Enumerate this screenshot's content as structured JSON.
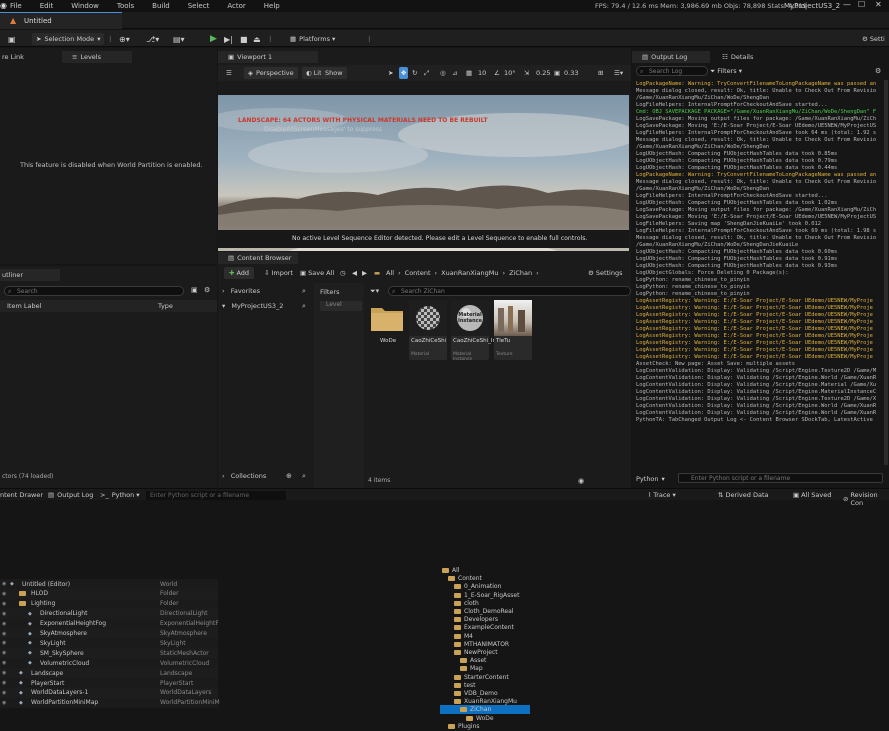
{
  "menu": [
    "File",
    "Edit",
    "Window",
    "Tools",
    "Build",
    "Select",
    "Actor",
    "Help"
  ],
  "stats": "FPS: 79.4   /   12.6 ms   Mem: 3,986.69 mb   Objs: 78,898   Stats: 4,019",
  "project_name": "MyProjectUS3_2",
  "window_controls": {
    "minimize": "—",
    "maximize": "☐",
    "close": "✕"
  },
  "doc_tab": "Untitled",
  "toolbar": {
    "selection_mode": "Selection Mode",
    "platforms": "Platforms",
    "settings": "Setti"
  },
  "left_panel": {
    "tab_link": "re Link",
    "tab_levels": "Levels",
    "disabled_msg": "This feature is disabled when World Partition is enabled."
  },
  "viewport": {
    "tab": "Viewport 1",
    "perspective": "Perspective",
    "lit": "Lit",
    "show": "Show",
    "grid": "10",
    "angle": "10°",
    "scale": "0.25",
    "cam": "0.33",
    "warning": "LANDSCAPE: 64 ACTORS WITH PHYSICAL MATERIALS NEED TO BE REBUILT",
    "warning_sub": "DisableAllScreenMessages' to suppress",
    "sequencer_msg": "No active Level Sequence Editor detected. Please edit a Level Sequence to enable full controls."
  },
  "outliner": {
    "tab": "utliner",
    "search_placeholder": "Search",
    "col_label": "Item Label",
    "col_type": "Type",
    "rows": [
      {
        "name": "Untitled (Editor)",
        "type": "World",
        "indent": 0
      },
      {
        "name": "HLOD",
        "type": "Folder",
        "indent": 1
      },
      {
        "name": "Lighting",
        "type": "Folder",
        "indent": 1
      },
      {
        "name": "DirectionalLight",
        "type": "DirectionalLight",
        "indent": 2
      },
      {
        "name": "ExponentialHeightFog",
        "type": "ExponentialHeightF",
        "indent": 2
      },
      {
        "name": "SkyAtmosphere",
        "type": "SkyAtmosphere",
        "indent": 2
      },
      {
        "name": "SkyLight",
        "type": "SkyLight",
        "indent": 2
      },
      {
        "name": "SM_SkySphere",
        "type": "StaticMeshActor",
        "indent": 2
      },
      {
        "name": "VolumetricCloud",
        "type": "VolumetricCloud",
        "indent": 2
      },
      {
        "name": "Landscape",
        "type": "Landscape",
        "indent": 1
      },
      {
        "name": "PlayerStart",
        "type": "PlayerStart",
        "indent": 1
      },
      {
        "name": "WorldDataLayers-1",
        "type": "WorldDataLayers",
        "indent": 1
      },
      {
        "name": "WorldPartitionMiniMap",
        "type": "WorldPartitionMiniM",
        "indent": 1
      }
    ],
    "actor_count": "ctors (74 loaded)"
  },
  "content_browser": {
    "tab": "Content Browser",
    "add": "Add",
    "import": "Import",
    "save_all": "Save All",
    "breadcrumb": [
      "All",
      "Content",
      "XuanRanXiangMu",
      "ZiChan"
    ],
    "settings": "Settings",
    "favorites": "Favorites",
    "root": "MyProjectUS3_2",
    "filters": "Filters",
    "level_filter": "Level",
    "search_placeholder": "Search ZiChan",
    "tree": [
      {
        "name": "All",
        "indent": 0
      },
      {
        "name": "Content",
        "indent": 1
      },
      {
        "name": "0_Animation",
        "indent": 2
      },
      {
        "name": "1_E-Soar_RigAsset",
        "indent": 2
      },
      {
        "name": "cloth",
        "indent": 2
      },
      {
        "name": "Cloth_DemoReal",
        "indent": 2
      },
      {
        "name": "Developers",
        "indent": 2
      },
      {
        "name": "ExampleContent",
        "indent": 2
      },
      {
        "name": "M4",
        "indent": 2
      },
      {
        "name": "MTHANIMATOR",
        "indent": 2
      },
      {
        "name": "NewProject",
        "indent": 2
      },
      {
        "name": "Asset",
        "indent": 3
      },
      {
        "name": "Map",
        "indent": 3
      },
      {
        "name": "StarterContent",
        "indent": 2
      },
      {
        "name": "test",
        "indent": 2
      },
      {
        "name": "VDB_Demo",
        "indent": 2
      },
      {
        "name": "XuanRanXiangMu",
        "indent": 2
      },
      {
        "name": "ZiChan",
        "indent": 3
      },
      {
        "name": "WoDe",
        "indent": 4
      },
      {
        "name": "Plugins",
        "indent": 1
      }
    ],
    "collections": "Collections",
    "assets": [
      {
        "label": "WoDe",
        "type": ""
      },
      {
        "label": "CaoZhiCeShi",
        "type": "Material"
      },
      {
        "label": "CaoZhiCeShi_Inst",
        "type": "Material Instance"
      },
      {
        "label": "TieTu",
        "type": "Texture"
      }
    ],
    "material_instance_label": "Material Instance",
    "items_count": "4 items"
  },
  "output_log": {
    "tab": "Output Log",
    "details_tab": "Details",
    "search_placeholder": "Search Log",
    "filters": "Filters",
    "lines": [
      {
        "t": "LogPackageName: Warning: TryConvertFilenameToLongPackageName was passed an",
        "c": "w"
      },
      {
        "t": "Message dialog closed, result: Ok, title: Unable to Check Out From Revisio",
        "c": "g"
      },
      {
        "t": "/Game/XuanRanXiangMu/ZiChan/WoDe/ShengDan",
        "c": "g"
      },
      {
        "t": "LogFileHelpers: InternalPromptForCheckoutAndSave started...",
        "c": "g"
      },
      {
        "t": "Cmd: OBJ SAVEPACKAGE PACKAGE=\"/Game/XuanRanXiangMu/ZiChan/WoDe/ShengDan\" F",
        "c": "c"
      },
      {
        "t": "LogSavePackage: Moving output files for package: /Game/XuanRanXiangMu/ZiCh",
        "c": "g"
      },
      {
        "t": "LogSavePackage: Moving 'E:/E-Soar Project/E-Soar UEdemo/UE5NEW/MyProjectUS",
        "c": "g"
      },
      {
        "t": "LogFileHelpers: InternalPromptForCheckoutAndSave took 64 ms (total: 1.92 s",
        "c": "g"
      },
      {
        "t": "Message dialog closed, result: Ok, title: Unable to Check Out From Revisio",
        "c": "g"
      },
      {
        "t": "/Game/XuanRanXiangMu/ZiChan/WoDe/ShengDan",
        "c": "g"
      },
      {
        "t": "LogUObjectHash: Compacting FUObjectHashTables data took    0.85ms",
        "c": "g"
      },
      {
        "t": "LogUObjectHash: Compacting FUObjectHashTables data took    0.79ms",
        "c": "g"
      },
      {
        "t": "LogUObjectHash: Compacting FUObjectHashTables data took    0.44ms",
        "c": "g"
      },
      {
        "t": "LogPackageName: Warning: TryConvertFilenameToLongPackageName was passed an",
        "c": "w"
      },
      {
        "t": "Message dialog closed, result: Ok, title: Unable to Check Out From Revisio",
        "c": "g"
      },
      {
        "t": "/Game/XuanRanXiangMu/ZiChan/WoDe/ShengDan",
        "c": "g"
      },
      {
        "t": "LogFileHelpers: InternalPromptForCheckoutAndSave started...",
        "c": "g"
      },
      {
        "t": "LogUObjectHash: Compacting FUObjectHashTables data took    1.02ms",
        "c": "g"
      },
      {
        "t": "LogSavePackage: Moving output files for package: /Game/XuanRanXiangMu/ZiCh",
        "c": "g"
      },
      {
        "t": "LogSavePackage: Moving 'E:/E-Soar Project/E-Soar UEdemo/UE5NEW/MyProjectUS",
        "c": "g"
      },
      {
        "t": "LogFileHelpers: Saving map 'ShengDanJieKuaiLe' took 0.012",
        "c": "g"
      },
      {
        "t": "LogFileHelpers: InternalPromptForCheckoutAndSave took 69 ms (total: 1.98 s",
        "c": "g"
      },
      {
        "t": "Message dialog closed, result: Ok, title: Unable to Check Out From Revisio",
        "c": "g"
      },
      {
        "t": "/Game/XuanRanXiangMu/ZiChan/WoDe/ShengDanJieKuaiLe",
        "c": "g"
      },
      {
        "t": "LogUObjectHash: Compacting FUObjectHashTables data took    0.60ms",
        "c": "g"
      },
      {
        "t": "LogUObjectHash: Compacting FUObjectHashTables data took    0.91ms",
        "c": "g"
      },
      {
        "t": "LogUObjectHash: Compacting FUObjectHashTables data took    0.93ms",
        "c": "g"
      },
      {
        "t": "LogUObjectGlobals: Force Deleting 0 Package(s):",
        "c": "g"
      },
      {
        "t": "LogPython: rename_chinese_to_pinyin",
        "c": "g"
      },
      {
        "t": "LogPython: rename_chinese_to_pinyin",
        "c": "g"
      },
      {
        "t": "LogPython: rename_chinese_to_pinyin",
        "c": "g"
      },
      {
        "t": "LogAssetRegistry: Warning: E:/E-Soar Project/E-Soar UEdemo/UE5NEW/MyProje",
        "c": "w"
      },
      {
        "t": "LogAssetRegistry: Warning: E:/E-Soar Project/E-Soar UEdemo/UE5NEW/MyProje",
        "c": "w"
      },
      {
        "t": "LogAssetRegistry: Warning: E:/E-Soar Project/E-Soar UEdemo/UE5NEW/MyProje",
        "c": "w"
      },
      {
        "t": "LogAssetRegistry: Warning: E:/E-Soar Project/E-Soar UEdemo/UE5NEW/MyProje",
        "c": "w"
      },
      {
        "t": "LogAssetRegistry: Warning: E:/E-Soar Project/E-Soar UEdemo/UE5NEW/MyProje",
        "c": "w"
      },
      {
        "t": "LogAssetRegistry: Warning: E:/E-Soar Project/E-Soar UEdemo/UE5NEW/MyProje",
        "c": "w"
      },
      {
        "t": "LogAssetRegistry: Warning: E:/E-Soar Project/E-Soar UEdemo/UE5NEW/MyProje",
        "c": "w"
      },
      {
        "t": "LogAssetRegistry: Warning: E:/E-Soar Project/E-Soar UEdemo/UE5NEW/MyProje",
        "c": "w"
      },
      {
        "t": "LogAssetRegistry: Warning: E:/E-Soar Project/E-Soar UEdemo/UE5NEW/MyProje",
        "c": "w"
      },
      {
        "t": "AssetCheck: New page: Asset Save: multiple assets",
        "c": "g"
      },
      {
        "t": "LogContentValidation: Display: Validating /Script/Engine.Texture2D /Game/M",
        "c": "g"
      },
      {
        "t": "LogContentValidation: Display: Validating /Script/Engine.World /Game/XuanR",
        "c": "g"
      },
      {
        "t": "LogContentValidation: Display: Validating /Script/Engine.Material /Game/Xu",
        "c": "g"
      },
      {
        "t": "LogContentValidation: Display: Validating /Script/Engine.MaterialInstanceC",
        "c": "g"
      },
      {
        "t": "LogContentValidation: Display: Validating /Script/Engine.Texture2D /Game/X",
        "c": "g"
      },
      {
        "t": "LogContentValidation: Display: Validating /Script/Engine.World /Game/XuanR",
        "c": "g"
      },
      {
        "t": "LogContentValidation: Display: Validating /Script/Engine.World /Game/XuanR",
        "c": "g"
      },
      {
        "t": "PythonTA: TabChanged  Output Log <- Content Browser SDockTab, LatestActive",
        "c": "g"
      }
    ],
    "python_label": "Python",
    "python_placeholder": "Enter Python script or a filename"
  },
  "statusbar": {
    "content_drawer": "ntent Drawer",
    "output_log": "Output Log",
    "python": "Python",
    "python_input": "Enter Python script or a filename",
    "trace": "Trace",
    "derived_data": "Derived Data",
    "all_saved": "All Saved",
    "revision": "Revision Con"
  },
  "colors": {
    "accent": "#4a90d9",
    "play": "#5cb85c",
    "folder": "#c9a255",
    "warning_text": "#c83a2e",
    "log_warning": "#e0b23c",
    "log_cmd": "#4ec94e"
  }
}
